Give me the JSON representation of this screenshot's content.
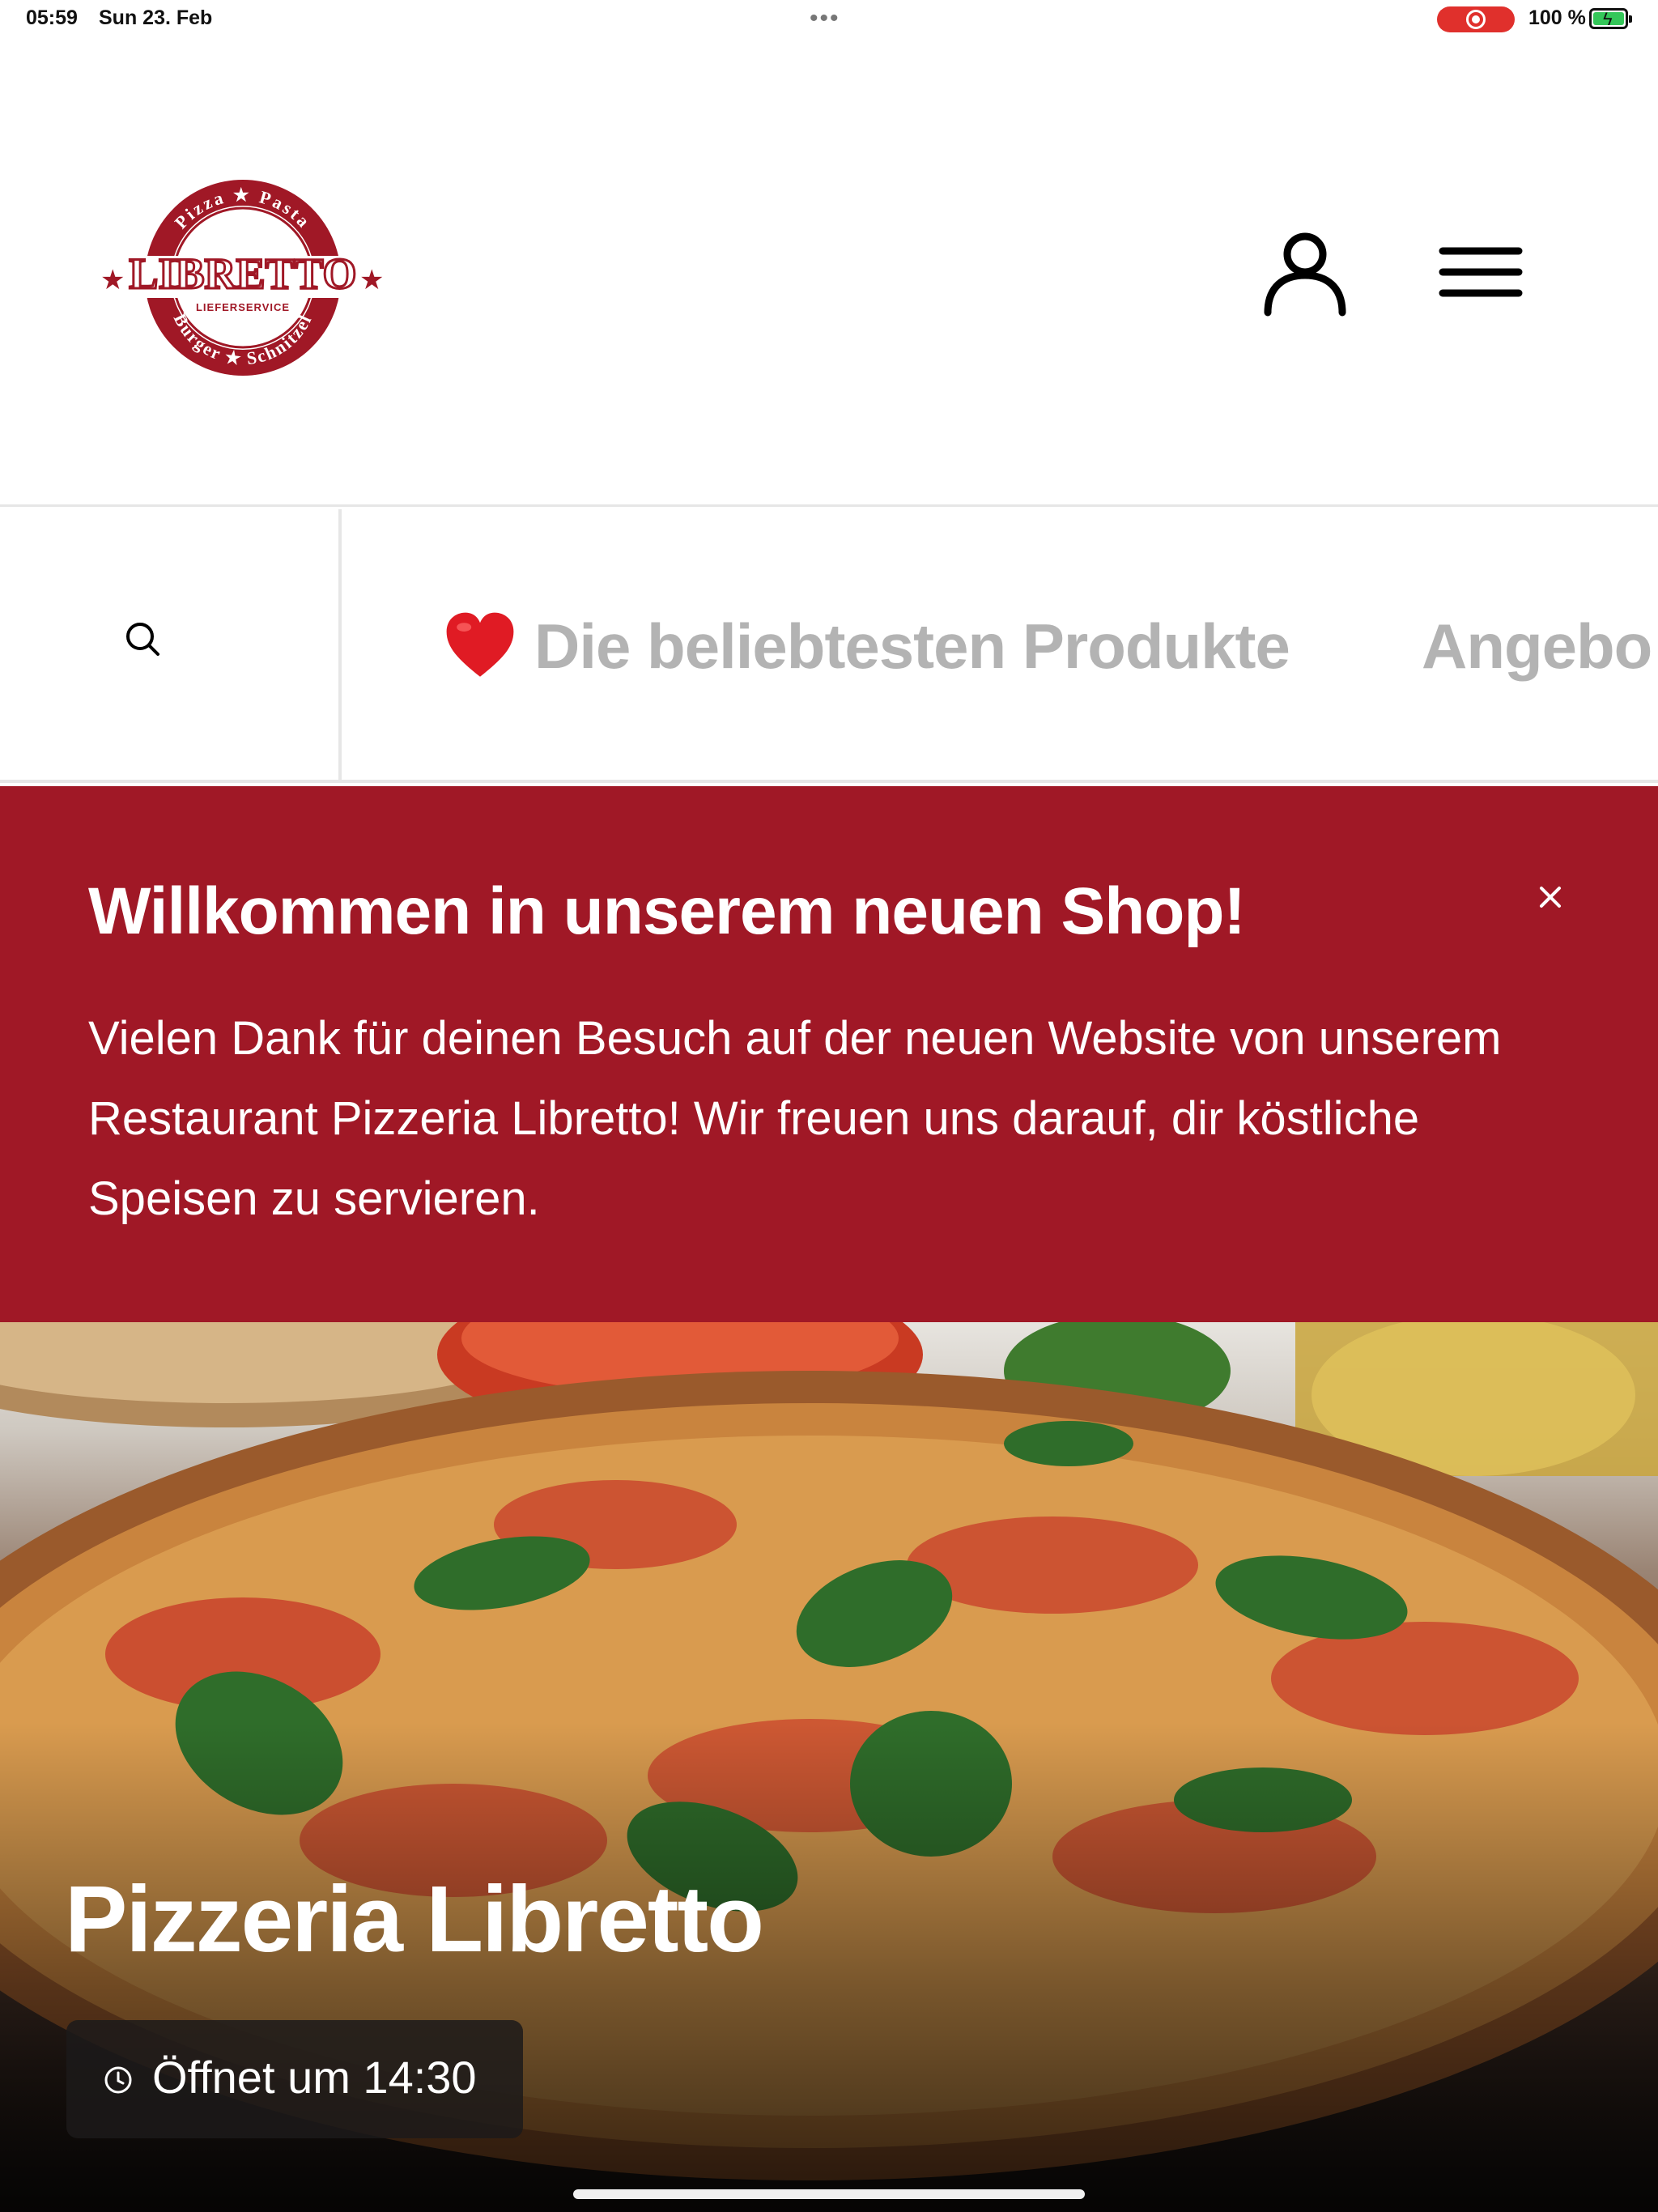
{
  "status_bar": {
    "time": "05:59",
    "date": "Sun 23. Feb",
    "battery": "100 %"
  },
  "header": {
    "logo": {
      "arc_top": "Pizza ★ Pasta",
      "name": "LIBRETTO",
      "sub": "LIEFERSERVICE",
      "arc_bottom": "Burger ★ Schnitzel"
    },
    "account_icon": "person-icon",
    "menu_icon": "hamburger-menu-icon"
  },
  "category_nav": {
    "search_icon": "search-icon",
    "items": [
      {
        "emoji": "heart-emoji",
        "label": "Die beliebtesten Produkte"
      },
      {
        "label": "Angebo"
      }
    ]
  },
  "welcome_banner": {
    "title": "Willkommen in unserem neuen Shop!",
    "body": "Vielen Dank für deinen Besuch auf der neuen Website von unserem Restaurant Pizzeria Libretto! Wir freuen uns darauf, dir köstliche Speisen zu servieren.",
    "close_icon": "close-icon",
    "background_color": "#a01826"
  },
  "hero": {
    "title": "Pizzeria Libretto",
    "hours": "Öffnet um 14:30",
    "clock_icon": "clock-icon"
  }
}
